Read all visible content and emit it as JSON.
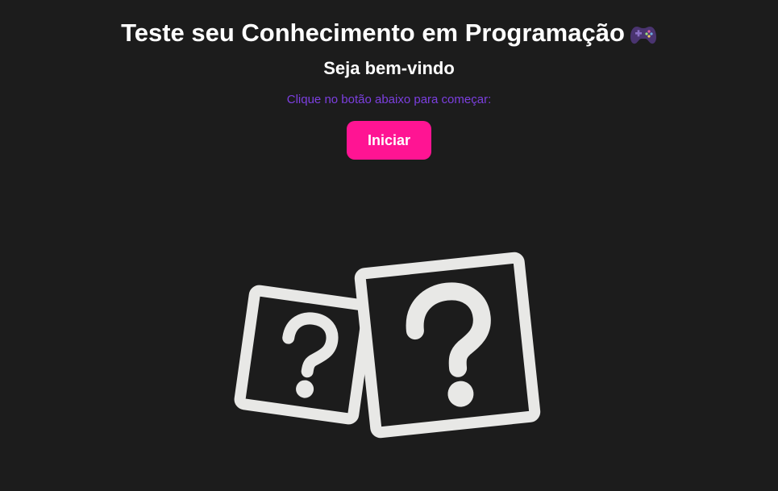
{
  "header": {
    "title": "Teste seu Conhecimento em Programação",
    "title_icon": "game-controller-icon"
  },
  "welcome": {
    "heading": "Seja bem-vindo",
    "instruction": "Clique no botão abaixo para começar:",
    "start_button_label": "Iniciar"
  },
  "illustration": {
    "icon": "question-mark-cards-icon"
  },
  "colors": {
    "background": "#1c1c1c",
    "text": "#ffffff",
    "instruction": "#7c3fe0",
    "button": "#ff1493",
    "illustration": "#e8e8e6"
  }
}
